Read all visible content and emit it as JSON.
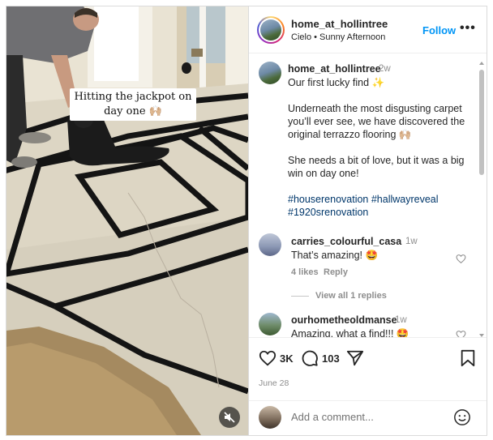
{
  "media": {
    "overlay_caption": "Hitting the jackpot on day one 🙌🏼"
  },
  "header": {
    "username": "home_at_hollintree",
    "subtitle": "Cielo • Sunny Afternoon",
    "follow_label": "Follow",
    "more_label": "•••"
  },
  "caption": {
    "username": "home_at_hollintree",
    "time": "2w",
    "paragraphs": [
      "Our first lucky find ✨",
      "Underneath the most disgusting carpet you’ll ever see, we have discovered the original terrazzo flooring 🙌🏼",
      "She needs a bit of love, but it was a big win on day one!"
    ],
    "hashtags": "#houserenovation #hallwayreveal #1920srenovation"
  },
  "comments": [
    {
      "username": "carries_colourful_casa",
      "time": "1w",
      "text": "That’s amazing! 🤩",
      "likes": "4 likes",
      "reply_label": "Reply",
      "view_replies": "View all 1 replies"
    },
    {
      "username": "ourhometheoldmanse",
      "time": "1w",
      "text": "Amazing, what a find!!! 🤩"
    }
  ],
  "actions": {
    "likes_count": "3K",
    "comments_count": "103",
    "date": "June 28"
  },
  "comment_box": {
    "placeholder": "Add a comment..."
  },
  "colors": {
    "accent": "#0095f6",
    "hashtag": "#00376b",
    "muted": "#8e8e8e"
  }
}
